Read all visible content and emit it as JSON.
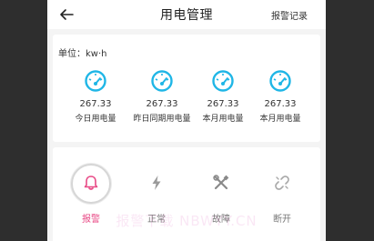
{
  "header": {
    "title": "用电管理",
    "right_link": "报警记录"
  },
  "stats": {
    "unit_label": "单位：kw·h",
    "items": [
      {
        "value": "267.33",
        "label": "今日用电量"
      },
      {
        "value": "267.33",
        "label": "昨日同期用电量"
      },
      {
        "value": "267.33",
        "label": "本月用电量"
      },
      {
        "value": "267.33",
        "label": "本月用电量"
      }
    ]
  },
  "status": {
    "items": [
      {
        "label": "报警",
        "icon": "bell-icon",
        "active": true
      },
      {
        "label": "正常",
        "icon": "lightning-icon",
        "active": false
      },
      {
        "label": "故障",
        "icon": "tools-icon",
        "active": false
      },
      {
        "label": "断开",
        "icon": "broken-link-icon",
        "active": false
      }
    ]
  },
  "watermark": "报警下载 NBWYY.CN",
  "colors": {
    "accent": "#e84a86",
    "gauge": "#1fb6e6",
    "muted_icon": "#9a9a9a"
  }
}
